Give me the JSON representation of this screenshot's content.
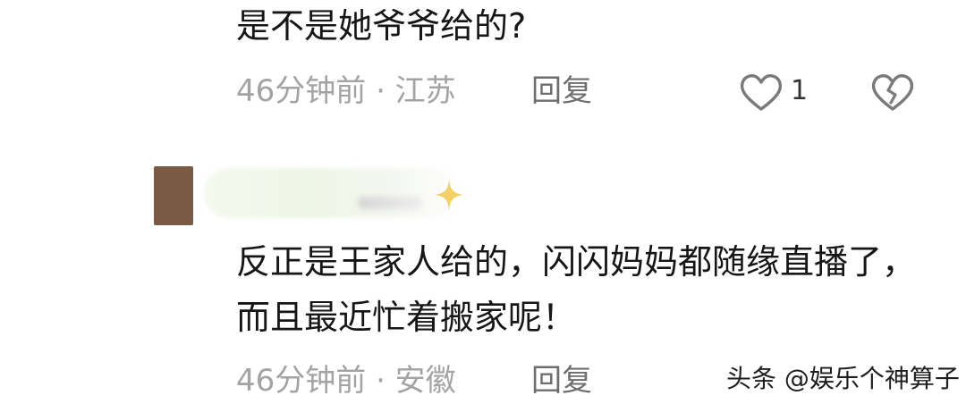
{
  "comments": [
    {
      "text": "是不是她爷爷给的?",
      "meta": "46分钟前 · 江苏",
      "reply_label": "回复",
      "like_count": "1"
    },
    {
      "text": "反正是王家人给的，闪闪妈妈都随缘直播了，而且最近忙着搬家呢！",
      "meta": "46分钟前 · 安徽",
      "reply_label": "回复"
    }
  ],
  "icons": {
    "like": "heart-outline-icon",
    "dislike": "broken-heart-icon",
    "sparkle": "sparkle-icon"
  },
  "watermark": "头条 @娱乐个神算子",
  "colors": {
    "text": "#161616",
    "meta": "#a3a3a3",
    "reply": "#6e6e6e",
    "avatar": "#7a5a43",
    "sparkle": "#f2c94c"
  }
}
